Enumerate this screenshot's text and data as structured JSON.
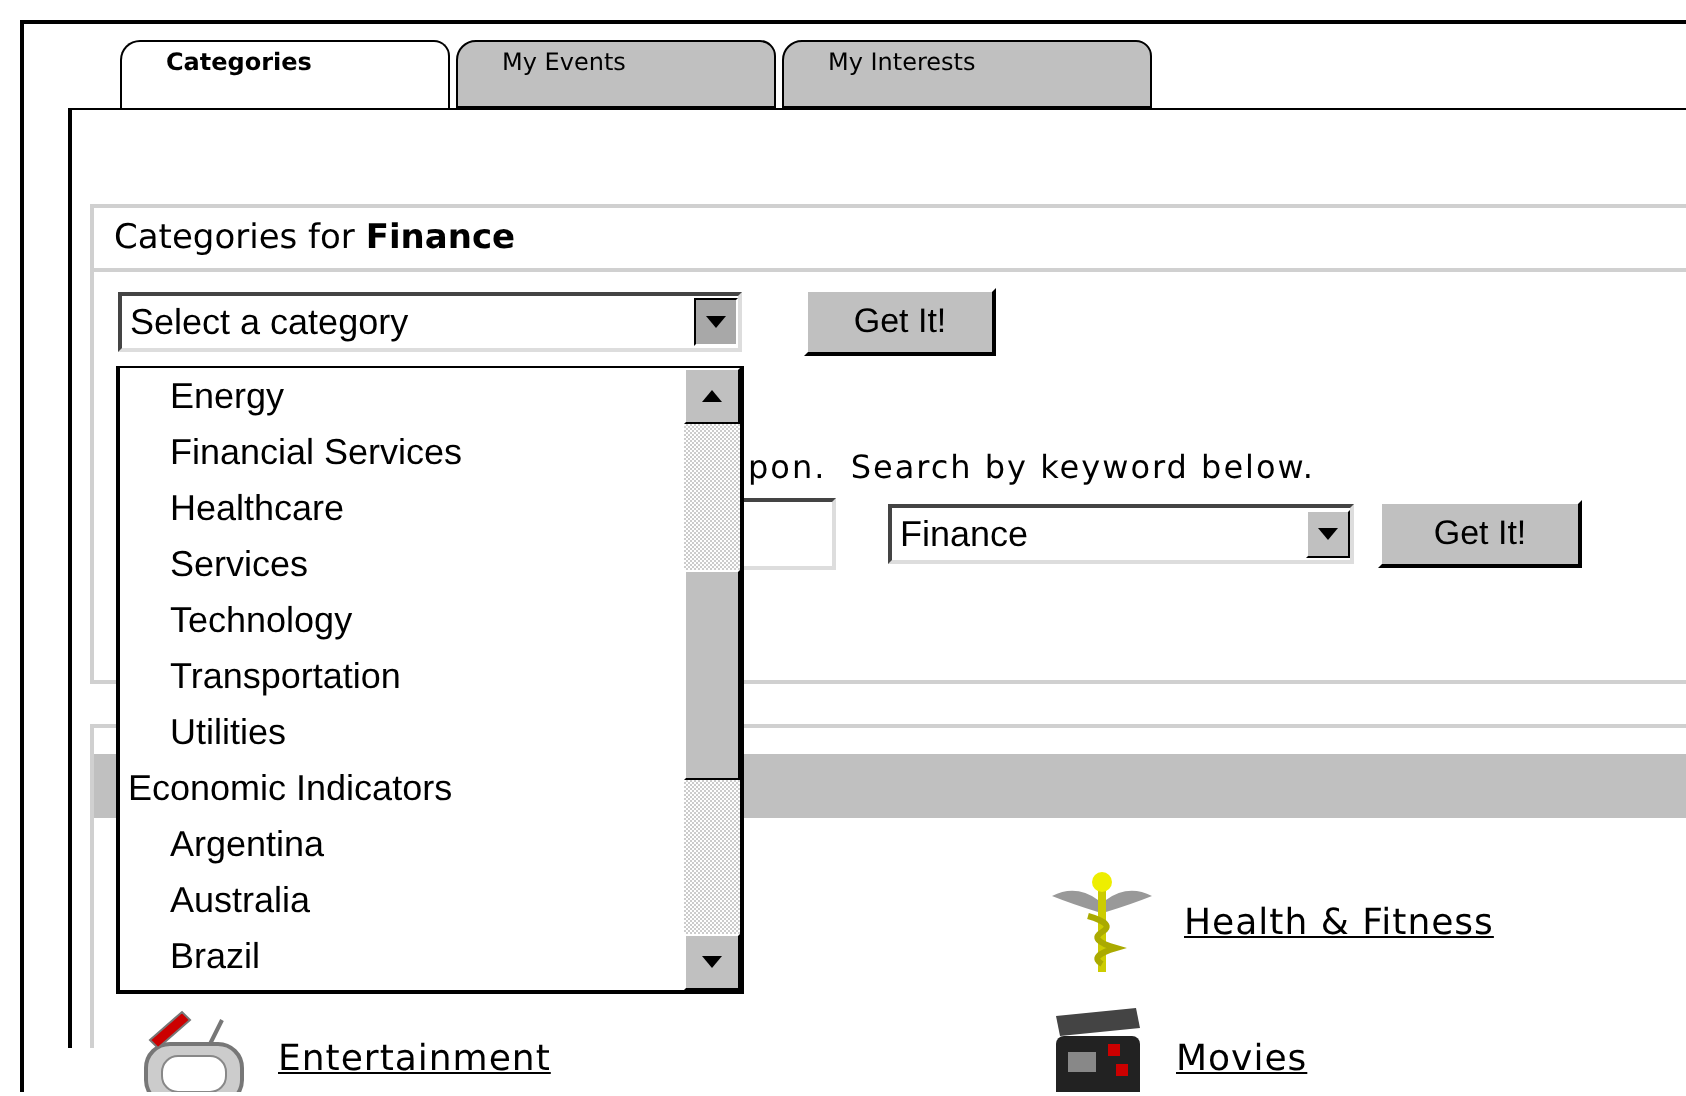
{
  "tabs": [
    {
      "label": "Categories",
      "selected": true
    },
    {
      "label": "My Events",
      "selected": false
    },
    {
      "label": "My Interests",
      "selected": false
    }
  ],
  "category_panel": {
    "title": "Categories for **Finance**",
    "select": {
      "value": "Select a category",
      "expanded": true,
      "options": [
        {
          "label": "Energy",
          "kind": "option"
        },
        {
          "label": "Financial Services",
          "kind": "option"
        },
        {
          "label": "Healthcare",
          "kind": "option"
        },
        {
          "label": "Services",
          "kind": "option"
        },
        {
          "label": "Technology",
          "kind": "option"
        },
        {
          "label": "Transportation",
          "kind": "option"
        },
        {
          "label": "Utilities",
          "kind": "option"
        },
        {
          "label": "Economic Indicators",
          "kind": "group"
        },
        {
          "label": "Argentina",
          "kind": "option"
        },
        {
          "label": "Australia",
          "kind": "option"
        },
        {
          "label": "Brazil",
          "kind": "option"
        }
      ]
    },
    "button": "Get It!",
    "keyword_text": "pon.  Search by keyword below.",
    "keyword_category": "Finance",
    "keyword_button": "Get It!"
  },
  "links": [
    {
      "label": "Health & Fitness",
      "kind": "caduceus"
    },
    {
      "label": "Entertainment",
      "kind": "tv"
    },
    {
      "label": "Movies",
      "kind": "clapper"
    }
  ]
}
